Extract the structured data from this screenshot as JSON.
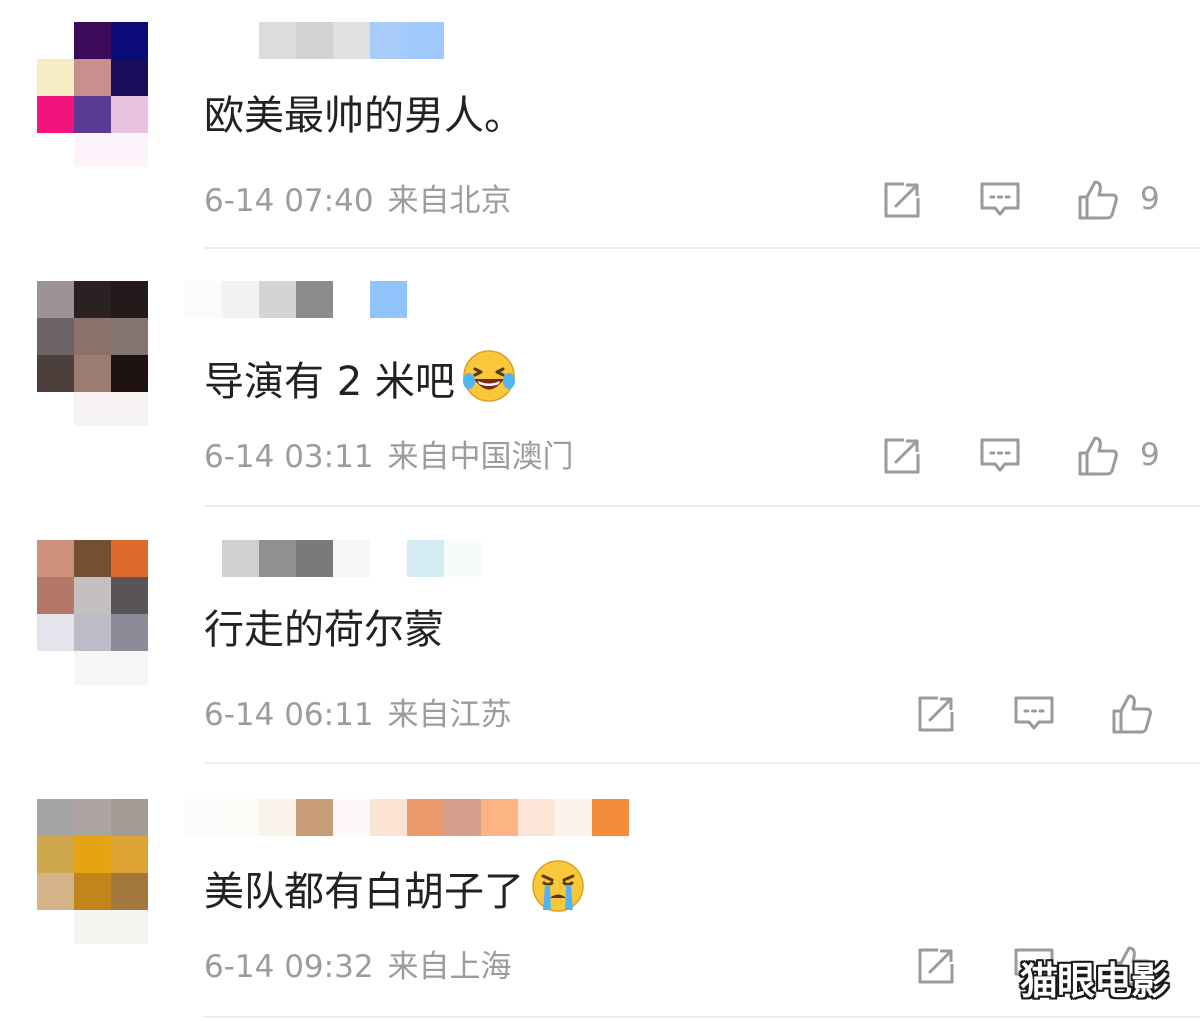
{
  "comments": [
    {
      "text": "欧美最帅的男人。",
      "date": "6-14 07:40",
      "location": "来自北京",
      "likes": "9",
      "emoji_icon": "",
      "avatar_colors": [
        "#ffffff",
        "#3c0c5a",
        "#0a0a78",
        "#f8ecc4",
        "#c8908c",
        "#1a0e5a",
        "#f0147c",
        "#5a3a94",
        "#e8c0e0"
      ],
      "avatar_fade": "#fdf4fb",
      "username_colors": [
        "#ffffff",
        "#ffffff",
        "#dcdcdc",
        "#d2d2d2",
        "#e0e0e0",
        "#a8ccfa",
        "#a0c8fa"
      ]
    },
    {
      "text": "导演有 2 米吧",
      "date": "6-14 03:11",
      "location": "来自中国澳门",
      "likes": "9",
      "emoji_icon": "laughing-tears-emoji",
      "avatar_colors": [
        "#9c9494",
        "#2a2222",
        "#221a1a",
        "#6c6464",
        "#8c706c",
        "#847470",
        "#4c3e3a",
        "#9c7c70",
        "#1e1212"
      ],
      "avatar_fade": "#f7f3f3",
      "username_colors": [
        "#fbfbfb",
        "#f2f2f2",
        "#d4d4d4",
        "#8c8c8c",
        "#ffffff",
        "#90c4fa"
      ]
    },
    {
      "text": "行走的荷尔蒙",
      "date": "6-14 06:11",
      "location": "来自江苏",
      "likes": "",
      "emoji_icon": "",
      "avatar_colors": [
        "#cc907c",
        "#745030",
        "#dc6a2c",
        "#b47868",
        "#c4c0c0",
        "#585458",
        "#e4e4ec",
        "#bcbcc8",
        "#8c8c98"
      ],
      "avatar_fade": "#f6f6f8",
      "username_colors": [
        "#ffffff",
        "#d0d0d0",
        "#909090",
        "#7a7a7a",
        "#f7f7f7",
        "#ffffff",
        "#d6ecf4",
        "#f6fbfc"
      ]
    },
    {
      "text": "美队都有白胡子了",
      "date": "6-14 09:32",
      "location": "来自上海",
      "likes": "",
      "emoji_icon": "crying-emoji",
      "avatar_colors": [
        "#a4a4a4",
        "#aca4a0",
        "#a49c94",
        "#d0a84c",
        "#e4a414",
        "#dca434",
        "#d4b488",
        "#c4841c",
        "#a4783c"
      ],
      "avatar_fade": "#f7f5f2",
      "username_colors": [
        "#fdfcfb",
        "#fdfbf8",
        "#fbf4ea",
        "#c89c74",
        "#fcf8fc",
        "#fbe4d4",
        "#ec9c6c",
        "#d4a08c",
        "#fcb484",
        "#fbe6d8",
        "#fcf4ec",
        "#f48c3c"
      ]
    }
  ],
  "actions": {
    "share_icon": "share-icon",
    "reply_icon": "reply-icon",
    "like_icon": "thumbs-up-icon"
  },
  "watermark": "猫眼电影",
  "colors": {
    "text": "#222222",
    "meta": "#9c9c9c",
    "divider": "#ececec"
  }
}
